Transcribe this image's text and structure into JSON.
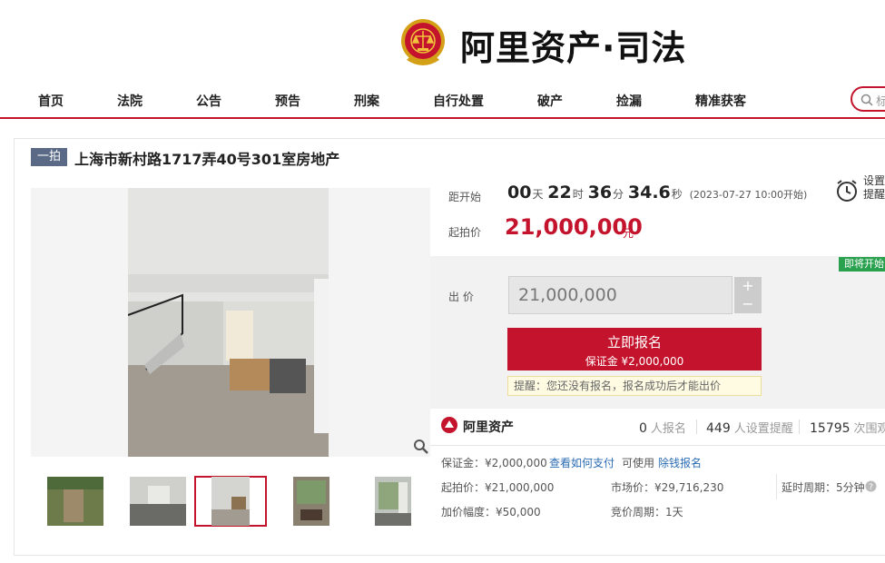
{
  "header": {
    "logo_text": "阿里资产·司法",
    "nav": [
      "首页",
      "法院",
      "公告",
      "预告",
      "刑案",
      "自行处置",
      "破产",
      "捡漏",
      "精准获客"
    ],
    "search_placeholder": "标",
    "brand_color": "#c4142d"
  },
  "item": {
    "tag": "一拍",
    "title": "上海市新村路1717弄40号301室房地产"
  },
  "countdown": {
    "label": "距开始",
    "days": "00",
    "days_unit": "天",
    "hours": "22",
    "hours_unit": "时",
    "minutes": "36",
    "minutes_unit": "分",
    "seconds": "34.6",
    "seconds_unit": "秒",
    "start_note": "(2023-07-27 10:00开始)"
  },
  "reminder": {
    "line1": "设置",
    "line2": "提醒",
    "icon": "alarm-clock-icon"
  },
  "price": {
    "label": "起拍价",
    "value": "21,000,000",
    "unit": "元"
  },
  "bid": {
    "soon_badge": "即将开始",
    "label": "出 价",
    "input_value": "21,000,000",
    "plus": "+",
    "minus": "−",
    "signup_label": "立即报名",
    "signup_deposit": "保证金 ¥2,000,000",
    "tip": "提醒：您还没有报名，报名成功后才能出价"
  },
  "stats": {
    "brand": "阿里资产",
    "signup_count": "0",
    "signup_label": "人报名",
    "reminder_count": "449",
    "reminder_label": "人设置提醒",
    "view_count": "15795",
    "view_label": "次围观"
  },
  "details": {
    "deposit": "保证金：¥2,000,000",
    "how_pay": "查看如何支付",
    "usable": "可使用",
    "credit": "除钱报名",
    "start_price": "起拍价：¥21,000,000",
    "market_price": "市场价：¥29,716,230",
    "delay": "延时周期：5分钟",
    "increment": "加价幅度：¥50,000",
    "bid_period": "竞价周期：1天"
  }
}
